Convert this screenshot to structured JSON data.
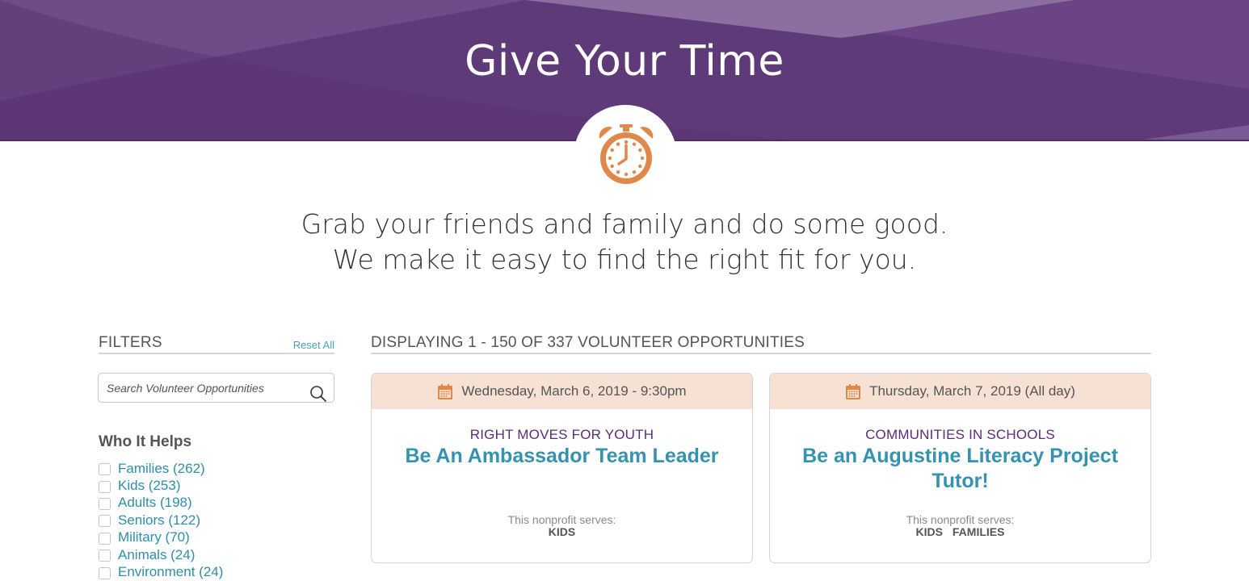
{
  "hero": {
    "title": "Give Your Time",
    "icon": "alarm-clock-icon",
    "accent_color": "#5f3a79"
  },
  "tagline": {
    "line1": "Grab your friends and family and do some good.",
    "line2": "We make it easy to find the right fit for you."
  },
  "filters": {
    "title": "FILTERS",
    "reset_label": "Reset All",
    "search_placeholder": "Search Volunteer Opportunities",
    "search_value": "",
    "who_it_helps": {
      "title": "Who It Helps",
      "options": [
        {
          "label": "Families (262)",
          "checked": false
        },
        {
          "label": "Kids (253)",
          "checked": false
        },
        {
          "label": "Adults (198)",
          "checked": false
        },
        {
          "label": "Seniors (122)",
          "checked": false
        },
        {
          "label": "Military (70)",
          "checked": false
        },
        {
          "label": "Animals (24)",
          "checked": false
        },
        {
          "label": "Environment (24)",
          "checked": false
        }
      ]
    }
  },
  "results": {
    "title": "DISPLAYING 1 - 150 OF 337 VOLUNTEER OPPORTUNITIES",
    "cards": [
      {
        "date": "Wednesday, March 6, 2019 - 9:30pm",
        "org": "RIGHT MOVES FOR YOUTH",
        "title": "Be An Ambassador Team Leader",
        "serves_label": "This nonprofit serves:",
        "serves": [
          "KIDS"
        ]
      },
      {
        "date": "Thursday, March 7, 2019 (All day)",
        "org": "COMMUNITIES IN SCHOOLS",
        "title": "Be an Augustine Literacy Project Tutor!",
        "serves_label": "This nonprofit serves:",
        "serves": [
          "KIDS",
          "FAMILIES"
        ]
      }
    ]
  }
}
